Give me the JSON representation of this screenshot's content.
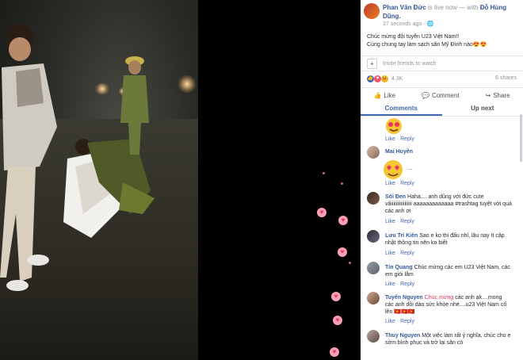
{
  "header": {
    "name": "Phan Văn Đức",
    "status": "is live now",
    "with_prefix": "— with",
    "tagged": "Đỗ Hùng Dũng.",
    "time": "37 seconds ago",
    "time_sep": "·",
    "globe": "🌐"
  },
  "post": {
    "line1": "Chúc mừng đội tuyển U23 Việt Nam!!",
    "line2": "Cùng chung tay làm sạch sân Mỹ Đình nào😍😍"
  },
  "invite": {
    "label": "Invite friends to watch",
    "icon": "person-plus-icon"
  },
  "reactions": {
    "count": "4.3K",
    "views": "6 shares",
    "icons": [
      "like",
      "love",
      "haha"
    ]
  },
  "actions": {
    "like": "Like",
    "comment": "Comment",
    "share": "Share"
  },
  "tabs": {
    "comments": "Comments",
    "upnext": "Up next"
  },
  "comments": [
    {
      "author": "",
      "text": "",
      "sticker": true,
      "like": "Like",
      "reply": "Reply",
      "dot": "·"
    },
    {
      "author": "Mai Huyền",
      "text": "",
      "sticker": true,
      "sticker_extra": "...",
      "like": "Like",
      "reply": "Reply",
      "dot": "·"
    },
    {
      "author": "Sói Đen",
      "text": "Haha.... anh dũng với đức cute vãiiiiiiiiiiiiiiiii aaaaaaaaaaaaa #trashtag tuyệt vời quá các anh ơi",
      "like": "Like",
      "reply": "Reply",
      "dot": "·"
    },
    {
      "author": "Lưu Trí Kiên",
      "text": "Sao e ko thi đấu nhỉ, lâu nay ít cập nhật thông tin nên ko biết",
      "like": "Like",
      "reply": "Reply",
      "dot": "·"
    },
    {
      "author": "Tín Quang",
      "text": "Chúc mừng các em U23 Việt Nam, các em giỏi lắm",
      "like": "Like",
      "reply": "Reply",
      "dot": "·"
    },
    {
      "author": "Tuyển Nguyen",
      "tag": "Chúc mừng",
      "text": "các anh ạk....mong các anh dồi dào sức khỏe nhé....u23 Việt Nam cố lên 🇻🇳🇻🇳🇻🇳",
      "like": "Like",
      "reply": "Reply",
      "dot": "·"
    },
    {
      "author": "Thuy Nguyen",
      "text": "Một việc làm rất ý nghĩa, chúc cho e sớm bình phục và trở lại sân cỏ",
      "like": "Like",
      "reply": "Reply",
      "dot": "·"
    }
  ],
  "colors": {
    "link": "#365899",
    "accent": "#4267b2",
    "heart": "#e8355a"
  }
}
